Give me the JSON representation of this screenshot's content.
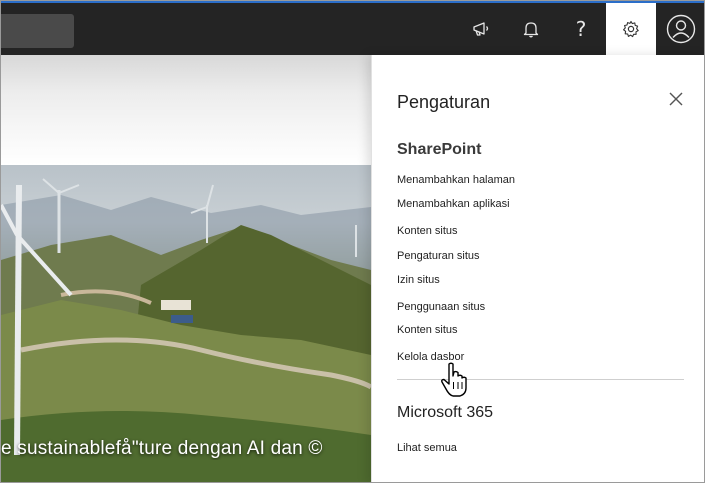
{
  "topbar": {
    "icons": [
      "megaphone-icon",
      "bell-icon",
      "help-icon",
      "gear-icon",
      "avatar-icon"
    ],
    "help_glyph": "?",
    "accent_color": "#2b6ec9",
    "bg_color": "#242424"
  },
  "hero": {
    "caption": "e sustainablefå\"ture dengan AI dan ©"
  },
  "settings": {
    "title": "Pengaturan",
    "sharepoint": {
      "heading": "SharePoint",
      "links": [
        "Menambahkan halaman",
        "Menambahkan aplikasi",
        "Konten situs",
        "Pengaturan situs",
        "Izin situs",
        "Penggunaan situs",
        "Konten situs",
        "Kelola dasbor"
      ]
    },
    "m365": {
      "heading": "Microsoft 365",
      "see_all": "Lihat semua"
    }
  }
}
